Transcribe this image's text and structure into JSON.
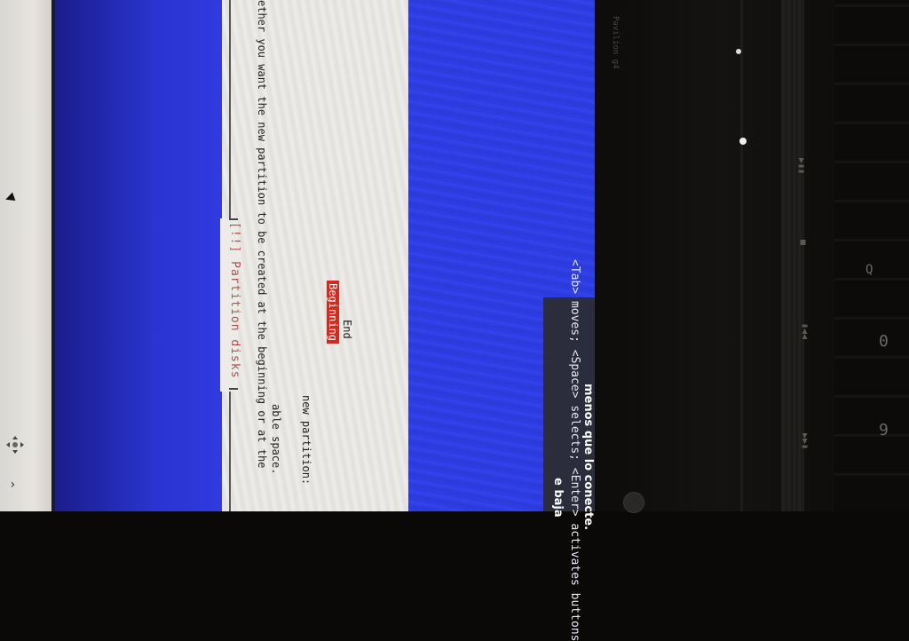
{
  "dialog": {
    "title": "[!!] Partition disks",
    "question_line1": "ether you want the new partition to be created at the beginning or at the",
    "question_line2": "able space.",
    "field_label": "new partition:",
    "options": [
      {
        "label": "Beginning",
        "selected": true
      },
      {
        "label": "End",
        "selected": false
      }
    ]
  },
  "help_bar": {
    "keys_text": "<Tab> moves; <Space> selects; <Enter> activates buttons"
  },
  "notification": {
    "line1": "e baja",
    "line2": "menos que lo conecte."
  },
  "laptop": {
    "bezel_label": "Pavilion g4",
    "keys": [
      "0",
      "9",
      "Q"
    ]
  },
  "colors": {
    "installer_blue": "#2a34d0",
    "dialog_bg": "#ecebe8",
    "selection_red": "#d22a1e",
    "title_red": "#b0504a"
  }
}
